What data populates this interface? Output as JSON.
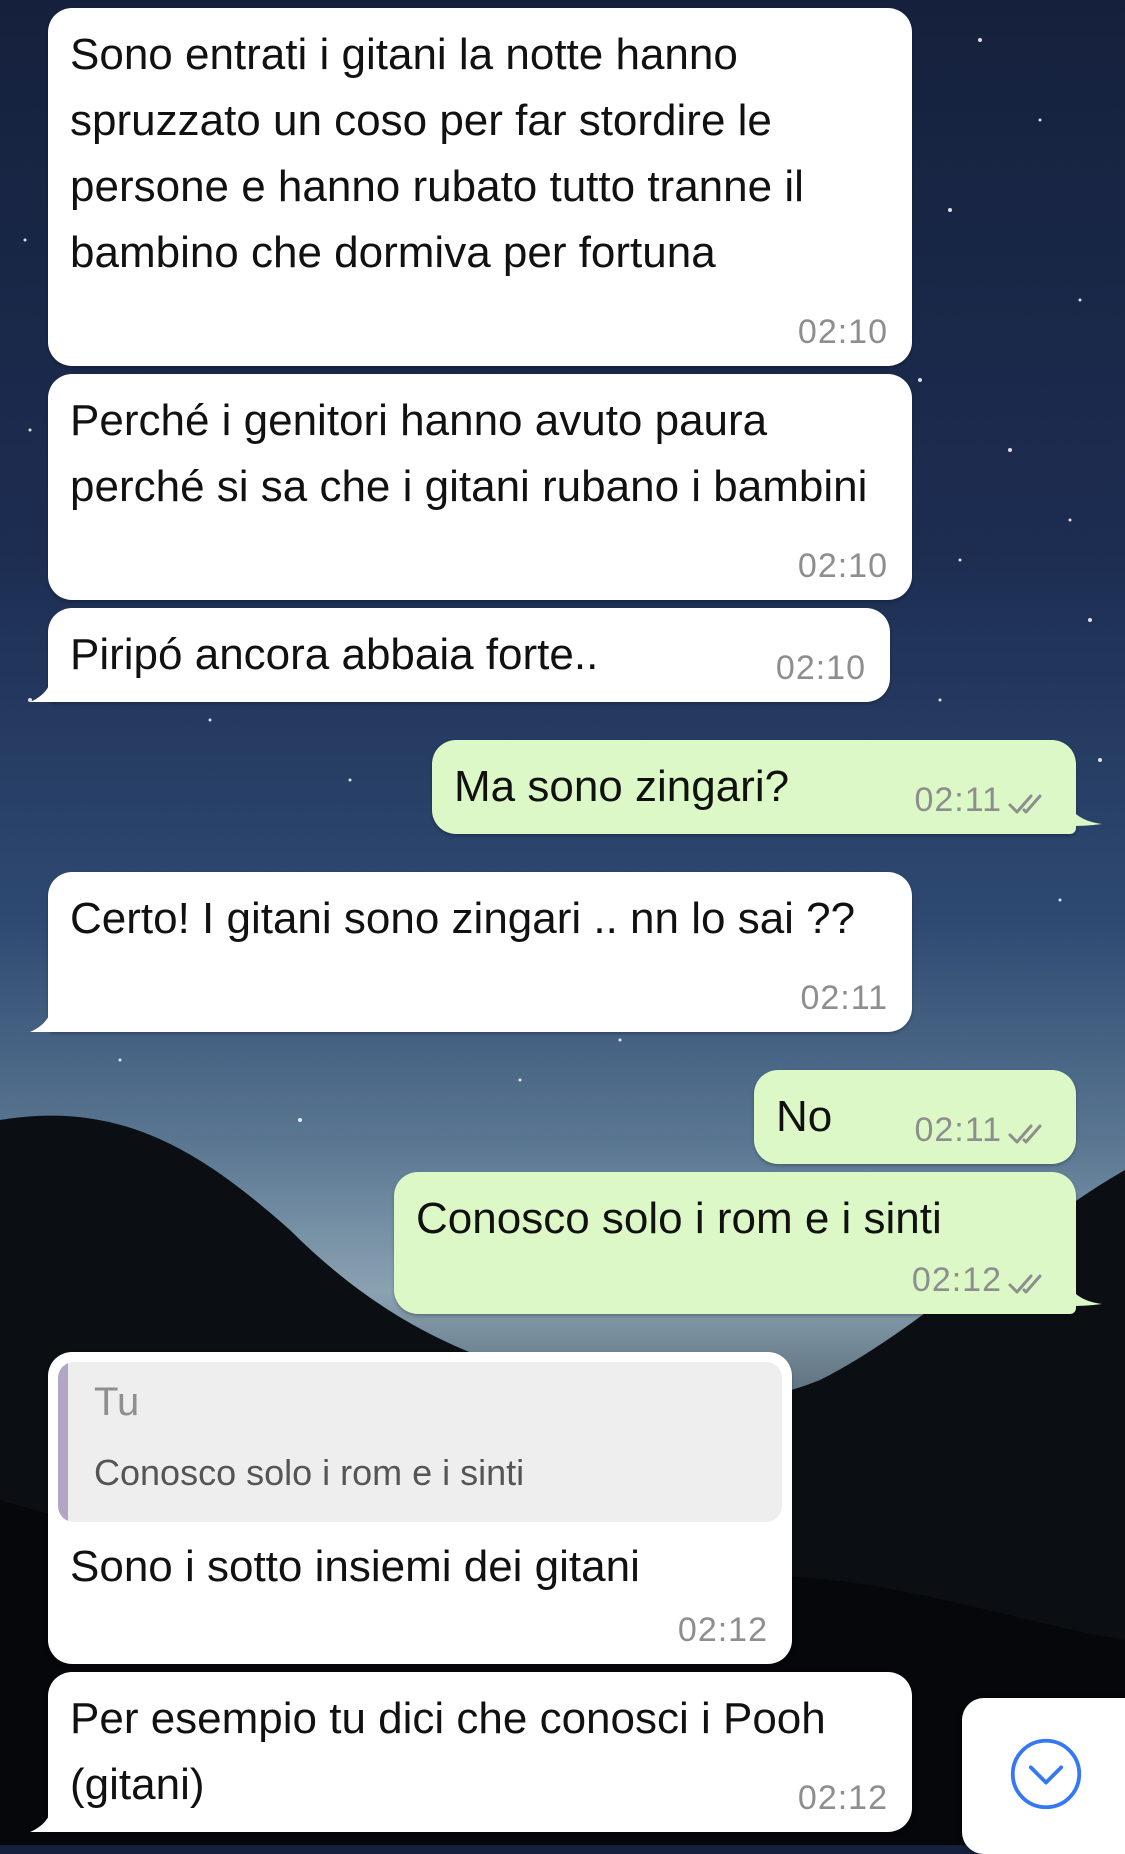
{
  "messages": [
    {
      "type": "in",
      "text": "Sono entrati i gitani la notte hanno spruzzato un coso per far stordire le persone e hanno rubato tutto tranne il bambino che dormiva per fortuna",
      "time": "02:10"
    },
    {
      "type": "in",
      "text": "Perché i genitori hanno avuto paura perché si sa che i gitani rubano i bambini",
      "time": "02:10"
    },
    {
      "type": "in",
      "text": "Piripó ancora abbaia forte..",
      "time": "02:10"
    },
    {
      "type": "out",
      "text": "Ma sono zingari?",
      "time": "02:11",
      "status": "read"
    },
    {
      "type": "in",
      "text": "Certo! I gitani sono zingari .. nn lo sai ??",
      "time": "02:11"
    },
    {
      "type": "out",
      "text": "No",
      "time": "02:11",
      "status": "read"
    },
    {
      "type": "out",
      "text": "Conosco solo i rom e i sinti",
      "time": "02:12",
      "status": "read"
    },
    {
      "type": "in",
      "text": "Sono i sotto insiemi dei gitani",
      "time": "02:12",
      "quote": {
        "author": "Tu",
        "text": "Conosco solo i rom e i sinti"
      }
    },
    {
      "type": "in",
      "text": "Per esempio tu dici che conosci i Pooh (gitani)",
      "time": "02:12"
    }
  ],
  "icons": {
    "ticks": "double-check-icon",
    "scroll": "chevron-down-circle-icon"
  },
  "colors": {
    "incoming": "#ffffff",
    "outgoing": "#dcf8c6",
    "time": "#8e8e8e",
    "accent": "#3478f6"
  }
}
